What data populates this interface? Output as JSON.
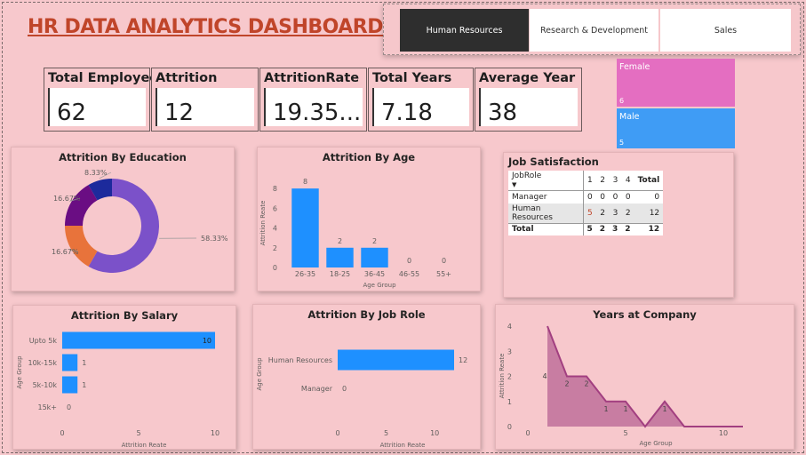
{
  "header": {
    "title": "HR DATA ANALYTICS DASHBOARD"
  },
  "tabs": [
    {
      "label": "Human Resources",
      "active": true
    },
    {
      "label": "Research & Development",
      "active": false
    },
    {
      "label": "Sales",
      "active": false
    }
  ],
  "kpis": [
    {
      "label": "Total Employees",
      "value": "62"
    },
    {
      "label": "Attrition",
      "value": "12"
    },
    {
      "label": "AttritionRate",
      "value": "19.35..."
    },
    {
      "label": "Total Years",
      "value": "7.18"
    },
    {
      "label": "Average Year",
      "value": "38"
    }
  ],
  "gender": [
    {
      "label": "Female",
      "value": "6",
      "color": "#e46ec1"
    },
    {
      "label": "Male",
      "value": "5",
      "color": "#3f9cf5"
    }
  ],
  "job_satisfaction": {
    "title": "Job Satisfaction",
    "row_header": "JobRole",
    "columns": [
      "1",
      "2",
      "3",
      "4",
      "Total"
    ],
    "rows": [
      {
        "label": "Manager",
        "values": [
          "0",
          "0",
          "0",
          "0",
          "0"
        ]
      },
      {
        "label": "Human Resources",
        "values": [
          "5",
          "2",
          "3",
          "2",
          "12"
        ]
      }
    ],
    "total": {
      "label": "Total",
      "values": [
        "5",
        "2",
        "3",
        "2",
        "12"
      ]
    }
  },
  "chart_data": [
    {
      "type": "pie",
      "title": "Attrition By Education",
      "slices": [
        {
          "value": 58.33,
          "label": "58.33%",
          "color": "#7b51c9"
        },
        {
          "value": 16.67,
          "label": "16.67%",
          "color": "#e8733b"
        },
        {
          "value": 16.67,
          "label": "16.67%",
          "color": "#6a0d83"
        },
        {
          "value": 8.33,
          "label": "8.33%",
          "color": "#1c2a9c"
        }
      ]
    },
    {
      "type": "bar",
      "title": "Attrition By Age",
      "categories": [
        "26-35",
        "18-25",
        "36-45",
        "46-55",
        "55+"
      ],
      "values": [
        8,
        2,
        2,
        0,
        0
      ],
      "xlabel": "Age Group",
      "ylabel": "Attrition Reate",
      "yticks": [
        0,
        2,
        4,
        6,
        8
      ],
      "ylim": [
        0,
        9
      ],
      "color": "#1e90ff"
    },
    {
      "type": "bar",
      "orientation": "horizontal",
      "title": "Attrition By Salary",
      "categories": [
        "Upto 5k",
        "10k-15k",
        "5k-10k",
        "15k+"
      ],
      "values": [
        10,
        1,
        1,
        0
      ],
      "xlabel": "Attrition Reate",
      "ylabel": "Age Group",
      "xticks": [
        0,
        5,
        10
      ],
      "xlim": [
        0,
        10
      ],
      "color": "#1e90ff"
    },
    {
      "type": "bar",
      "orientation": "horizontal",
      "title": "Attrition By Job Role",
      "categories": [
        "Human Resources",
        "Manager"
      ],
      "values": [
        12,
        0
      ],
      "xlabel": "Attrition Reate",
      "ylabel": "Age Group",
      "xticks": [
        0,
        5,
        10
      ],
      "xlim": [
        0,
        12
      ],
      "color": "#1e90ff"
    },
    {
      "type": "area",
      "title": "Years at Company",
      "x": [
        1,
        2,
        3,
        4,
        5,
        6,
        7,
        8,
        9,
        10,
        11
      ],
      "values": [
        4,
        2,
        2,
        1,
        1,
        0,
        1,
        0,
        0,
        0,
        0
      ],
      "data_labels": [
        {
          "x": 1,
          "text": "4"
        },
        {
          "x": 2,
          "text": "2"
        },
        {
          "x": 3,
          "text": "2"
        },
        {
          "x": 4,
          "text": "1"
        },
        {
          "x": 5,
          "text": "1"
        },
        {
          "x": 7,
          "text": "1"
        }
      ],
      "xlabel": "Age Group",
      "ylabel": "Attrition Reate",
      "xticks": [
        0,
        5,
        10
      ],
      "yticks": [
        0,
        1,
        2,
        3,
        4
      ],
      "xlim": [
        0,
        12
      ],
      "ylim": [
        0,
        4
      ],
      "color": "#a23f80"
    }
  ]
}
